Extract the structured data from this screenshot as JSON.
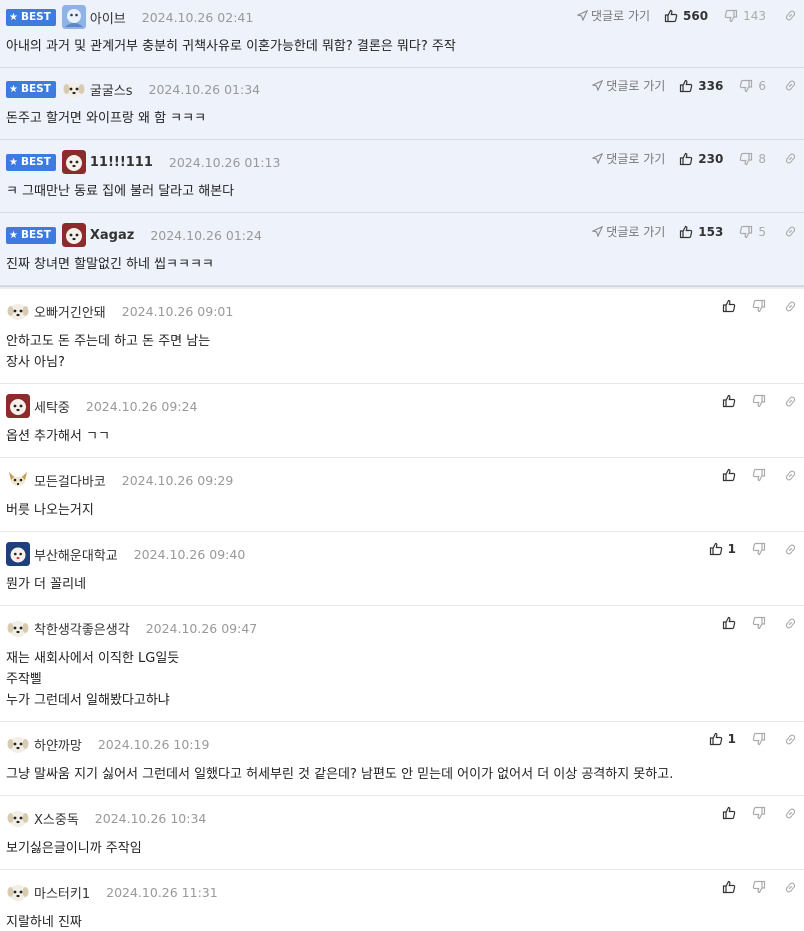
{
  "best_badge": "BEST",
  "goto_label": "댓글로 가기",
  "best_comments": [
    {
      "nick": "아이브",
      "date": "2024.10.26 02:41",
      "text": "아내의 과거 및 관계거부 충분히 귀책사유로 이혼가능한데 뭐함? 결론은 뭐다? 주작",
      "up": "560",
      "down": "143",
      "avatar": "blue"
    },
    {
      "nick": "굴굴스s",
      "date": "2024.10.26 01:34",
      "text": "돈주고 할거면 와이프랑 왜 함 ㅋㅋㅋ",
      "up": "336",
      "down": "6",
      "avatar": "pup"
    },
    {
      "nick": "11!!!111",
      "date": "2024.10.26 01:13",
      "text": "ㅋ 그때만난 동료 집에 불러 달라고 해본다",
      "up": "230",
      "down": "8",
      "avatar": "dog"
    },
    {
      "nick": "Xagaz",
      "date": "2024.10.26 01:24",
      "text": "진짜 창녀면 할말없긴 하네 씹ㅋㅋㅋㅋ",
      "up": "153",
      "down": "5",
      "avatar": "dog"
    }
  ],
  "comments": [
    {
      "nick": "오빠거긴안돼",
      "date": "2024.10.26 09:01",
      "lines": [
        "안하고도 돈 주는데 하고 돈 주면 남는",
        "장사 아님?"
      ],
      "up": "",
      "avatar": "pup"
    },
    {
      "nick": "세탁중",
      "date": "2024.10.26 09:24",
      "lines": [
        "옵션 추가해서 ㄱㄱ"
      ],
      "up": "",
      "avatar": "dog"
    },
    {
      "nick": "모든걸다바코",
      "date": "2024.10.26 09:29",
      "lines": [
        "버릇 나오는거지"
      ],
      "up": "",
      "avatar": "fox"
    },
    {
      "nick": "부산해운대학교",
      "date": "2024.10.26 09:40",
      "lines": [
        "뭔가 더 꼴리네"
      ],
      "up": "1",
      "avatar": "navy"
    },
    {
      "nick": "착한생각좋은생각",
      "date": "2024.10.26 09:47",
      "lines": [
        "재는 새회사에서 이직한 LG일듯",
        "주작삘",
        "누가 그런데서 일해봤다고하냐"
      ],
      "up": "",
      "avatar": "pup"
    },
    {
      "nick": "하얀까망",
      "date": "2024.10.26 10:19",
      "lines": [
        "그냥 말싸움 지기 싫어서 그런데서 일했다고 허세부린 것 같은데? 남편도 안 믿는데 어이가 없어서 더 이상 공격하지 못하고."
      ],
      "up": "1",
      "avatar": "pup"
    },
    {
      "nick": "X스중독",
      "date": "2024.10.26 10:34",
      "lines": [
        "보기싫은글이니까 주작임"
      ],
      "up": "",
      "avatar": "pup"
    },
    {
      "nick": "마스터키1",
      "date": "2024.10.26 11:31",
      "lines": [
        "지랄하네 진짜"
      ],
      "up": "",
      "avatar": "pup"
    }
  ],
  "colors": {
    "best_bg": "#eef3fb",
    "badge": "#3d7be0",
    "date": "#999999"
  }
}
